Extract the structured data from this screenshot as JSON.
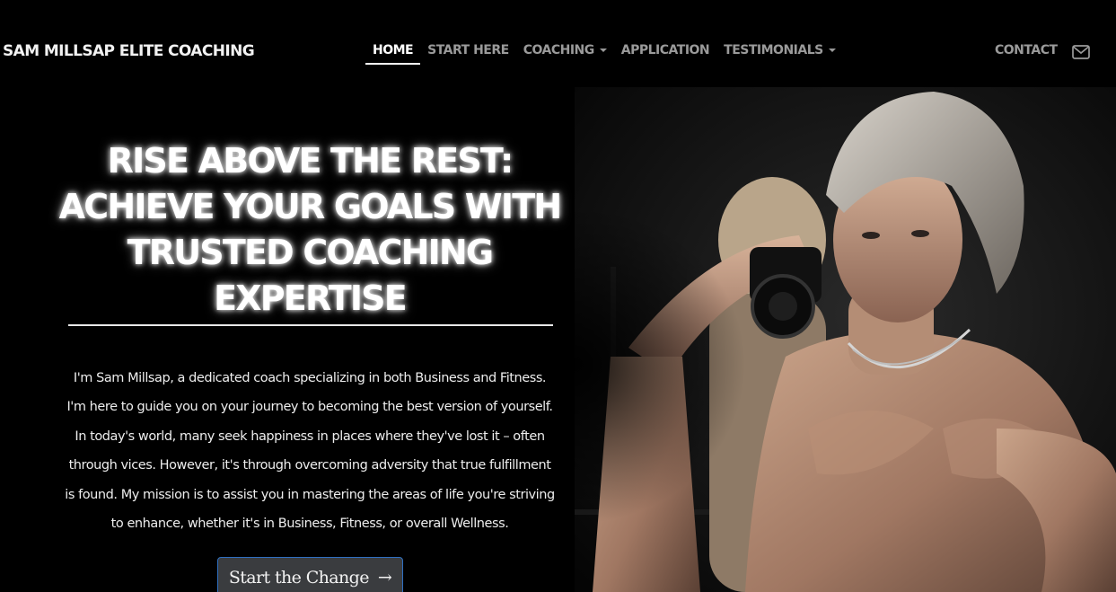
{
  "navbar": {
    "brand": "SAM MILLSAP ELITE COACHING",
    "links": [
      {
        "label": "HOME",
        "active": true,
        "dropdown": false
      },
      {
        "label": "START HERE",
        "active": false,
        "dropdown": false
      },
      {
        "label": "COACHING",
        "active": false,
        "dropdown": true
      },
      {
        "label": "APPLICATION",
        "active": false,
        "dropdown": false
      },
      {
        "label": "TESTIMONIALS",
        "active": false,
        "dropdown": true
      }
    ],
    "contact_label": "CONTACT",
    "contact_icon": "envelope-icon"
  },
  "hero": {
    "headline_lines": [
      "RISE ABOVE THE REST:",
      "ACHIEVE YOUR GOALS WITH",
      "TRUSTED COACHING",
      "EXPERTISE"
    ],
    "intro": "I'm Sam Millsap, a dedicated coach specializing in both Business and Fitness. I'm here to guide you on your journey to becoming the best version of yourself. In today's world, many seek happiness in places where they've lost it – often through vices. However, it's through overcoming adversity that true fulfillment is found. My mission is to assist you in mastering the areas of life you're striving to enhance, whether it's in Business, Fitness, or overall Wellness.",
    "cta_label": "Start the Change",
    "cta_arrow": "→",
    "photo_icon": "coach-mirror-selfie-photo"
  },
  "colors": {
    "background": "#000000",
    "nav_inactive": "#9a9a9a",
    "nav_active": "#ffffff",
    "cta_bg": "#3a3c3f",
    "cta_border": "#2f6fc0"
  }
}
